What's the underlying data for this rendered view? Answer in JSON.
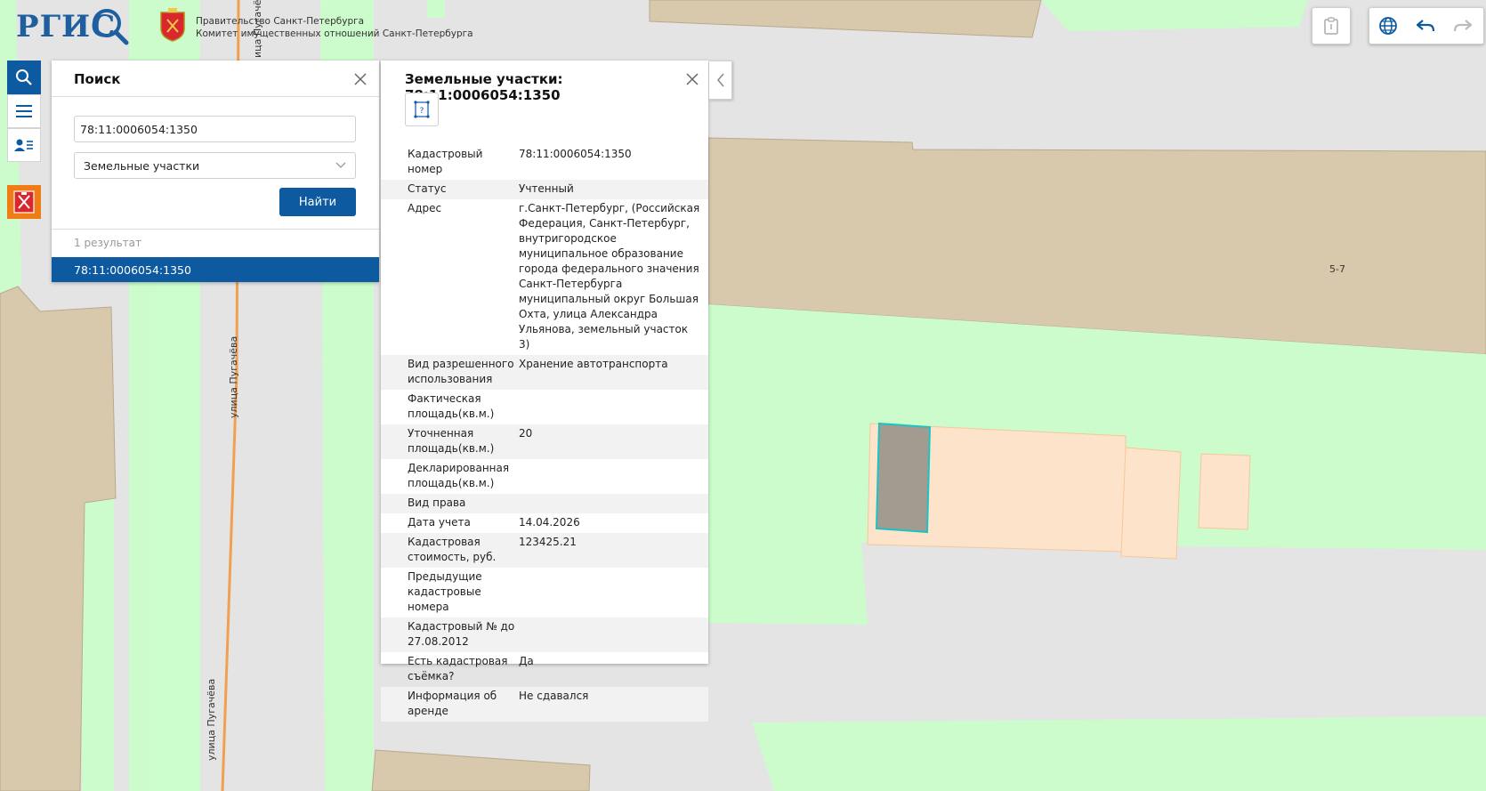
{
  "header": {
    "logo_text": "РГИС",
    "org_line1": "Правительство Санкт-Петербурга",
    "org_line2": "Комитет имущественных отношений Санкт-Петербурга"
  },
  "toolbar": {
    "clipboard_icon": "clipboard-icon",
    "globe_icon": "globe-icon",
    "undo_icon": "undo-icon",
    "redo_icon": "redo-icon"
  },
  "sidebar": {
    "items": [
      {
        "icon": "search-icon",
        "active": true
      },
      {
        "icon": "menu-icon",
        "active": false
      },
      {
        "icon": "user-list-icon",
        "active": false
      }
    ],
    "spb_icon": "spb-emblem-icon"
  },
  "search": {
    "title": "Поиск",
    "query": "78:11:0006054:1350",
    "type_selected": "Земельные участки",
    "submit_label": "Найти",
    "result_count": "1 результат",
    "results": [
      "78:11:0006054:1350"
    ]
  },
  "info": {
    "title": "Земельные участки: 78:11:0006054:1350",
    "attributes": [
      {
        "key": "Кадастровый номер",
        "value": "78:11:0006054:1350"
      },
      {
        "key": "Статус",
        "value": "Учтенный"
      },
      {
        "key": "Адрес",
        "value": "г.Санкт-Петербург, (Российская Федерация, Санкт-Петербург, внутригородское муниципальное образование города федерального значения Санкт-Петербурга муниципальный округ Большая Охта, улица Александра Ульянова, земельный участок 3)"
      },
      {
        "key": "Вид разрешенного использования",
        "value": "Хранение автотранспорта"
      },
      {
        "key": "Фактическая площадь(кв.м.)",
        "value": ""
      },
      {
        "key": "Уточненная площадь(кв.м.)",
        "value": "20"
      },
      {
        "key": "Декларированная площадь(кв.м.)",
        "value": ""
      },
      {
        "key": "Вид права",
        "value": ""
      },
      {
        "key": "Дата учета",
        "value": "14.04.2026"
      },
      {
        "key": "Кадастровая стоимость, руб.",
        "value": "123425.21"
      },
      {
        "key": "Предыдущие кадастровые номера",
        "value": ""
      },
      {
        "key": "Кадастровый № до 27.08.2012",
        "value": ""
      },
      {
        "key": "Есть кадастровая съёмка?",
        "value": "Да"
      },
      {
        "key": "Информация об аренде",
        "value": "Не сдавался"
      }
    ]
  },
  "map": {
    "labels": {
      "street_top": "ица Пугачёва",
      "street_mid": "улица Пугачёва",
      "street_bottom": "улица Пугачёва",
      "building_number": "5-7"
    },
    "colors": {
      "background": "#e4e4e4",
      "green": "#ccfccc",
      "building": "#d8c9ad",
      "parcel": "#fde3c9",
      "selected": "#a39a90",
      "selected_border": "#19c4c4",
      "road": "#f0a050"
    }
  }
}
